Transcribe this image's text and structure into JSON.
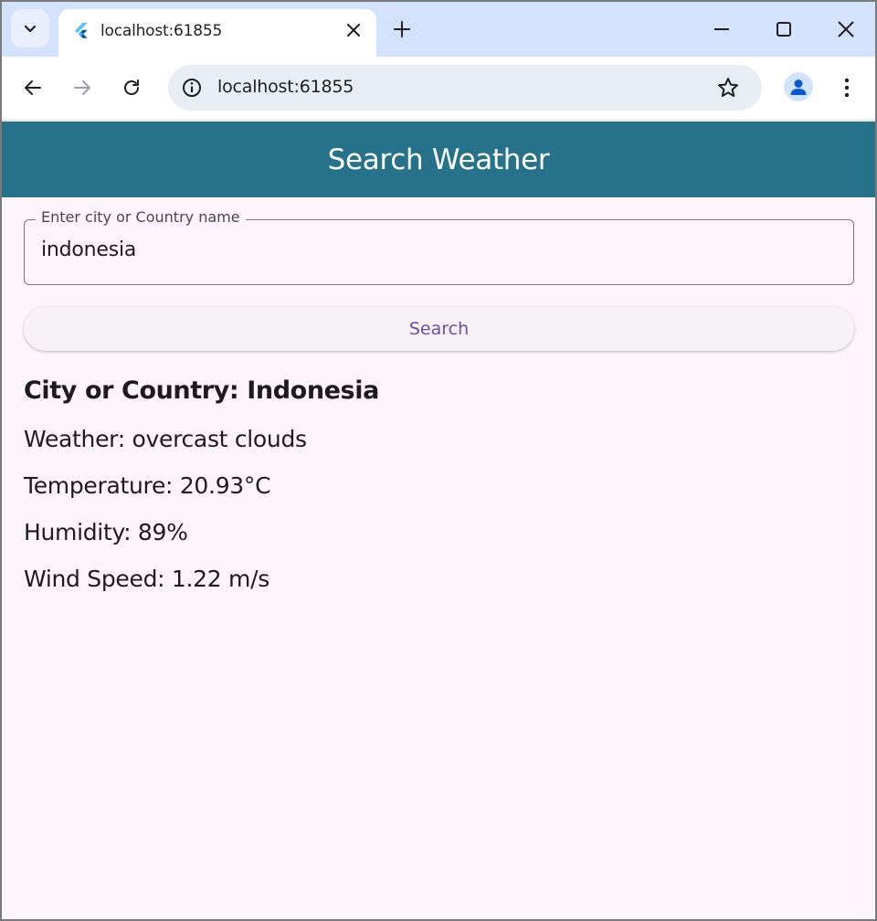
{
  "browser": {
    "tab_title": "localhost:61855",
    "url": "localhost:61855"
  },
  "app": {
    "title": "Search Weather",
    "search_field": {
      "label": "Enter city or Country name",
      "value": "indonesia"
    },
    "search_button_label": "Search",
    "result": {
      "title": "City or Country: Indonesia",
      "weather": "Weather: overcast clouds",
      "temperature": "Temperature: 20.93°C",
      "humidity": "Humidity: 89%",
      "wind_speed": "Wind Speed: 1.22 m/s"
    }
  },
  "colors": {
    "appbar": "#25728a",
    "background": "#fcf5fc",
    "button_text": "#6750a4",
    "tabstrip": "#d3e3fd"
  },
  "icons": [
    "tab-search-icon",
    "flutter-icon",
    "close-icon",
    "plus-icon",
    "minimize-icon",
    "maximize-icon",
    "window-close-icon",
    "back-arrow-icon",
    "forward-arrow-icon",
    "reload-icon",
    "info-icon",
    "star-icon",
    "profile-icon",
    "more-vert-icon"
  ]
}
